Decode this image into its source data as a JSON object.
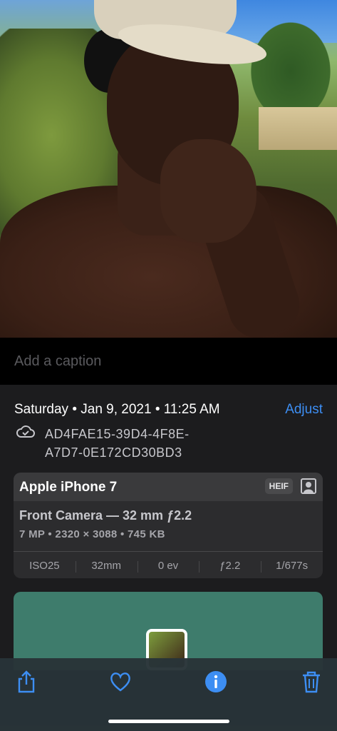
{
  "caption": {
    "placeholder": "Add a caption"
  },
  "info": {
    "date": "Saturday • Jan 9, 2021 • 11:25 AM",
    "adjust_label": "Adjust",
    "cloud_icon": "icloud-icon",
    "photo_id_line1": "AD4FAE15-39D4-4F8E-",
    "photo_id_line2": "A7D7-0E172CD30BD3"
  },
  "camera_card": {
    "device": "Apple iPhone 7",
    "format_badge": "HEIF",
    "lens": "Front Camera — 32 mm ƒ2.2",
    "specs": "7 MP • 2320 × 3088 • 745 KB",
    "exif": [
      "ISO25",
      "32mm",
      "0 ev",
      "ƒ2.2",
      "1/677s"
    ]
  },
  "toolbar": {
    "icons": [
      "share-icon",
      "heart-icon",
      "info-icon",
      "trash-icon"
    ],
    "accent": "#3d8ef3"
  },
  "colors": {
    "accent": "#3d8ef3",
    "background": "#1c1c1e"
  }
}
